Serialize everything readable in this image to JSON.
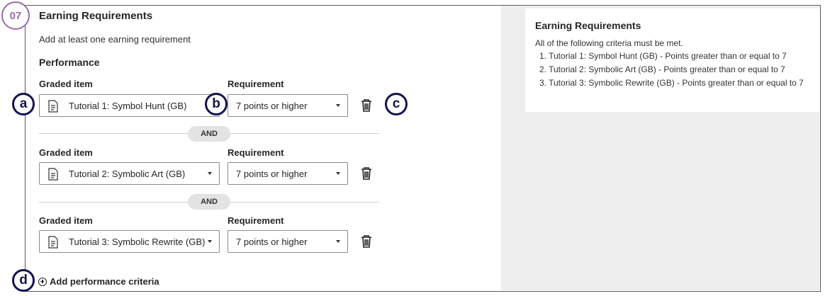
{
  "step_badge": "07",
  "callouts": {
    "a": "a",
    "b": "b",
    "c": "c",
    "d": "d"
  },
  "form": {
    "title": "Earning Requirements",
    "subtitle": "Add at least one earning requirement",
    "section": "Performance",
    "col_graded": "Graded item",
    "col_requirement": "Requirement",
    "rows": [
      {
        "graded_item": "Tutorial 1: Symbol Hunt (GB)",
        "requirement": "7 points or higher"
      },
      {
        "graded_item": "Tutorial 2: Symbolic Art (GB)",
        "requirement": "7 points or higher"
      },
      {
        "graded_item": "Tutorial 3: Symbolic Rewrite (GB)",
        "requirement": "7 points or higher"
      }
    ],
    "and_label": "AND",
    "add_criteria": "Add performance criteria"
  },
  "summary": {
    "title": "Earning Requirements",
    "intro": "All of the following criteria must be met.",
    "items": [
      "1. Tutorial 1: Symbol Hunt (GB) - Points greater than or equal to 7",
      "2. Tutorial 2: Symbolic Art (GB) - Points greater than or equal to 7",
      "3. Tutorial 3: Symbolic Rewrite (GB) - Points greater than or equal to 7"
    ]
  },
  "icons": {
    "doc": "document-icon",
    "trash": "trash-icon",
    "plus": "plus-circle-icon",
    "caret": "chevron-down-icon"
  },
  "colors": {
    "badge": "#9b6aa8",
    "callout": "#14134f",
    "panel": "#eeeeee"
  }
}
